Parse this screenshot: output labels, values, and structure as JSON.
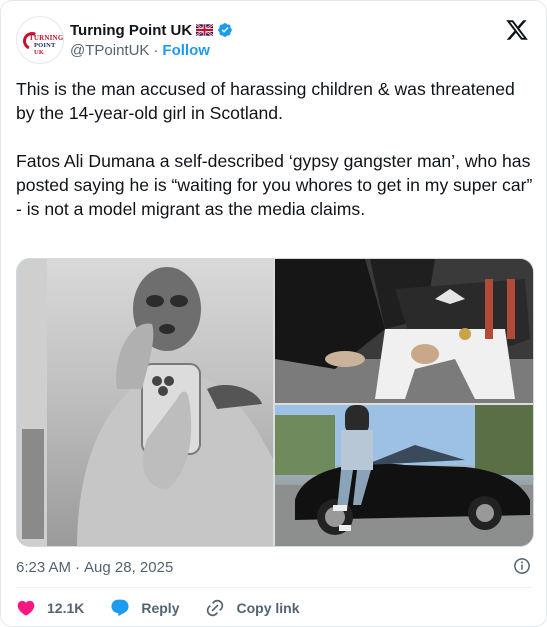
{
  "account": {
    "name": "Turning Point UK",
    "handle": "@TPointUK",
    "follow_label": "Follow",
    "avatar_text_line1": "TURNING",
    "avatar_text_line2_a": "POINT",
    "avatar_text_line2_b": "UK"
  },
  "post": {
    "paragraph1": "This is the man accused of harassing children & was threatened by the 14-year-old girl in Scotland.",
    "paragraph2": "Fatos Ali Dumana a self-described ‘gypsy gangster man’, who has posted saying he is “waiting for you whores to get in my super car” - is not a model migrant as the media claims.",
    "time": "6:23 AM",
    "date": "Aug 28, 2025"
  },
  "actions": {
    "likes": "12.1K",
    "reply_label": "Reply",
    "copy_link_label": "Copy link"
  },
  "colors": {
    "accent": "#1d9bf0",
    "like": "#f91880",
    "muted": "#536471",
    "text": "#0f1419"
  },
  "icons": [
    "uk-flag-icon",
    "verified-badge-icon",
    "x-logo-icon",
    "info-icon",
    "heart-icon",
    "reply-bubble-icon",
    "link-icon"
  ]
}
